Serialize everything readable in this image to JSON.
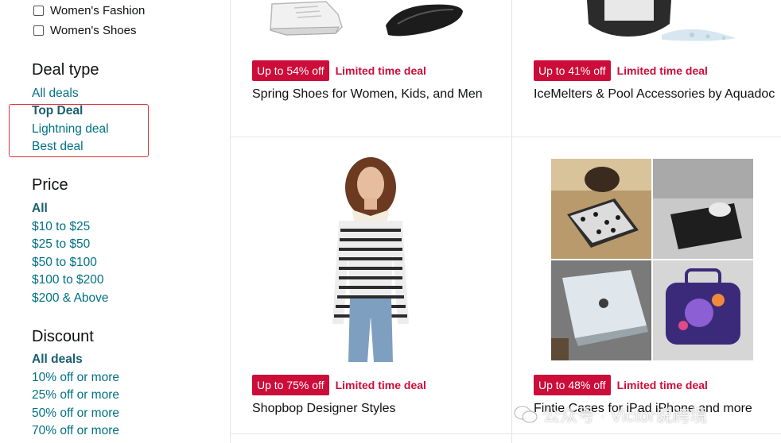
{
  "sidebar": {
    "checkboxes": [
      "Women's Fashion",
      "Women's Shoes"
    ],
    "deal_type": {
      "title": "Deal type",
      "items": [
        "All deals",
        "Top Deal",
        "Lightning deal",
        "Best deal"
      ]
    },
    "price": {
      "title": "Price",
      "items": [
        "All",
        "$10 to $25",
        "$25 to $50",
        "$50 to $100",
        "$100 to $200",
        "$200 & Above"
      ]
    },
    "discount": {
      "title": "Discount",
      "items": [
        "All deals",
        "10% off or more",
        "25% off or more",
        "50% off or more",
        "70% off or more"
      ]
    }
  },
  "products": [
    {
      "discount": "Up to 54% off",
      "deal_label": "Limited time deal",
      "title": "Spring Shoes for Women, Kids, and Men"
    },
    {
      "discount": "Up to 41% off",
      "deal_label": "Limited time deal",
      "title": "IceMelters & Pool Accessories by Aquadoc"
    },
    {
      "discount": "Up to 75% off",
      "deal_label": "Limited time deal",
      "title": "Shopbop Designer Styles"
    },
    {
      "discount": "Up to 48% off",
      "deal_label": "Limited time deal",
      "title": "Fintie Cases for iPad iPhone and more"
    }
  ],
  "watermark": "公众号 · Victor说跨境",
  "colors": {
    "link": "#007185",
    "deal_red": "#cc0c39",
    "highlight": "#e0323c"
  }
}
